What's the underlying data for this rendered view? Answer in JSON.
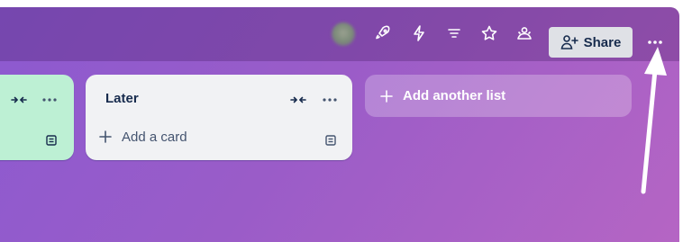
{
  "header": {
    "share_label": "Share",
    "icons": [
      "avatar",
      "power-ups-icon",
      "automation-icon",
      "filter-icon",
      "star-icon",
      "visibility-icon",
      "add-member-icon",
      "more-icon"
    ]
  },
  "lists": [
    {
      "title": "",
      "color": "#bdf0d4",
      "add_card_label": ""
    },
    {
      "title": "Later",
      "color": "#f1f2f4",
      "add_card_label": "Add a card"
    }
  ],
  "add_list": {
    "label": "Add another list"
  },
  "annotation": {
    "type": "arrow",
    "color": "#ffffff",
    "points_to": "more-icon"
  },
  "colors": {
    "board_gradient_start": "#8c5ad0",
    "board_gradient_end": "#b565c4",
    "share_bg": "#dfe1e6",
    "text_dark": "#172b4d"
  }
}
